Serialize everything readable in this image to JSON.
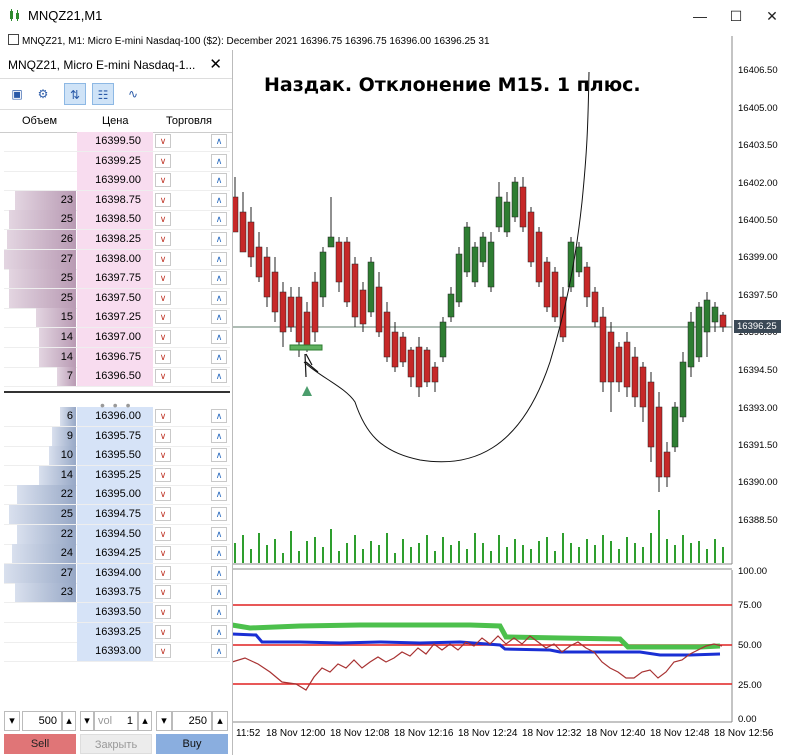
{
  "window": {
    "title": "MNQZ21,M1",
    "minimize": "—",
    "maximize": "☐",
    "close": "✕"
  },
  "chart": {
    "info": "MNQZ21, M1:  Micro E-mini Nasdaq-100 ($2): December 2021  16396.75 16396.75 16396.00 16396.25  31",
    "headline": "Наздак. Отклонение М15. 1 плюс.",
    "price_labels": [
      "16406.50",
      "16405.00",
      "16403.50",
      "16402.00",
      "16400.50",
      "16399.00",
      "16397.50",
      "16396.00",
      "16394.50",
      "16393.00",
      "16391.50",
      "16390.00",
      "16388.50"
    ],
    "current_price": "16396.25",
    "osc_labels": [
      "100.00",
      "75.00",
      "50.00",
      "25.00",
      "0.00"
    ],
    "time_labels": [
      "11:52",
      "18 Nov 12:00",
      "18 Nov 12:08",
      "18 Nov 12:16",
      "18 Nov 12:24",
      "18 Nov 12:32",
      "18 Nov 12:40",
      "18 Nov 12:48",
      "18 Nov 12:56"
    ],
    "colors": {
      "bull": "#2e7d32",
      "bear": "#c62828",
      "osc_green": "#4cc04c",
      "osc_blue": "#1a2fd4",
      "osc_red": "#a83232",
      "levels": "#e02020"
    }
  },
  "dom": {
    "title": "MNQZ21, Micro E-mini Nasdaq-1...",
    "close_icon": "✕",
    "columns": {
      "volume": "Объем",
      "price": "Цена",
      "trade": "Торговля"
    },
    "asks": [
      {
        "price": "16399.50",
        "vol": ""
      },
      {
        "price": "16399.25",
        "vol": ""
      },
      {
        "price": "16399.00",
        "vol": ""
      },
      {
        "price": "16398.75",
        "vol": "23"
      },
      {
        "price": "16398.50",
        "vol": "25"
      },
      {
        "price": "16398.25",
        "vol": "26"
      },
      {
        "price": "16398.00",
        "vol": "27"
      },
      {
        "price": "16397.75",
        "vol": "25"
      },
      {
        "price": "16397.50",
        "vol": "25"
      },
      {
        "price": "16397.25",
        "vol": "15"
      },
      {
        "price": "16397.00",
        "vol": "14"
      },
      {
        "price": "16396.75",
        "vol": "14"
      },
      {
        "price": "16396.50",
        "vol": "7"
      }
    ],
    "bids": [
      {
        "price": "16396.00",
        "vol": "6"
      },
      {
        "price": "16395.75",
        "vol": "9"
      },
      {
        "price": "16395.50",
        "vol": "10"
      },
      {
        "price": "16395.25",
        "vol": "14"
      },
      {
        "price": "16395.00",
        "vol": "22"
      },
      {
        "price": "16394.75",
        "vol": "25"
      },
      {
        "price": "16394.50",
        "vol": "22"
      },
      {
        "price": "16394.25",
        "vol": "24"
      },
      {
        "price": "16394.00",
        "vol": "27"
      },
      {
        "price": "16393.75",
        "vol": "23"
      },
      {
        "price": "16393.50",
        "vol": ""
      },
      {
        "price": "16393.25",
        "vol": ""
      },
      {
        "price": "16393.00",
        "vol": ""
      }
    ],
    "dots": "• • •",
    "spin1": "500",
    "vol_label": "vol",
    "spin2": "1",
    "spin3": "250",
    "sell": "Sell",
    "close_btn": "Закрыть",
    "buy": "Buy"
  }
}
